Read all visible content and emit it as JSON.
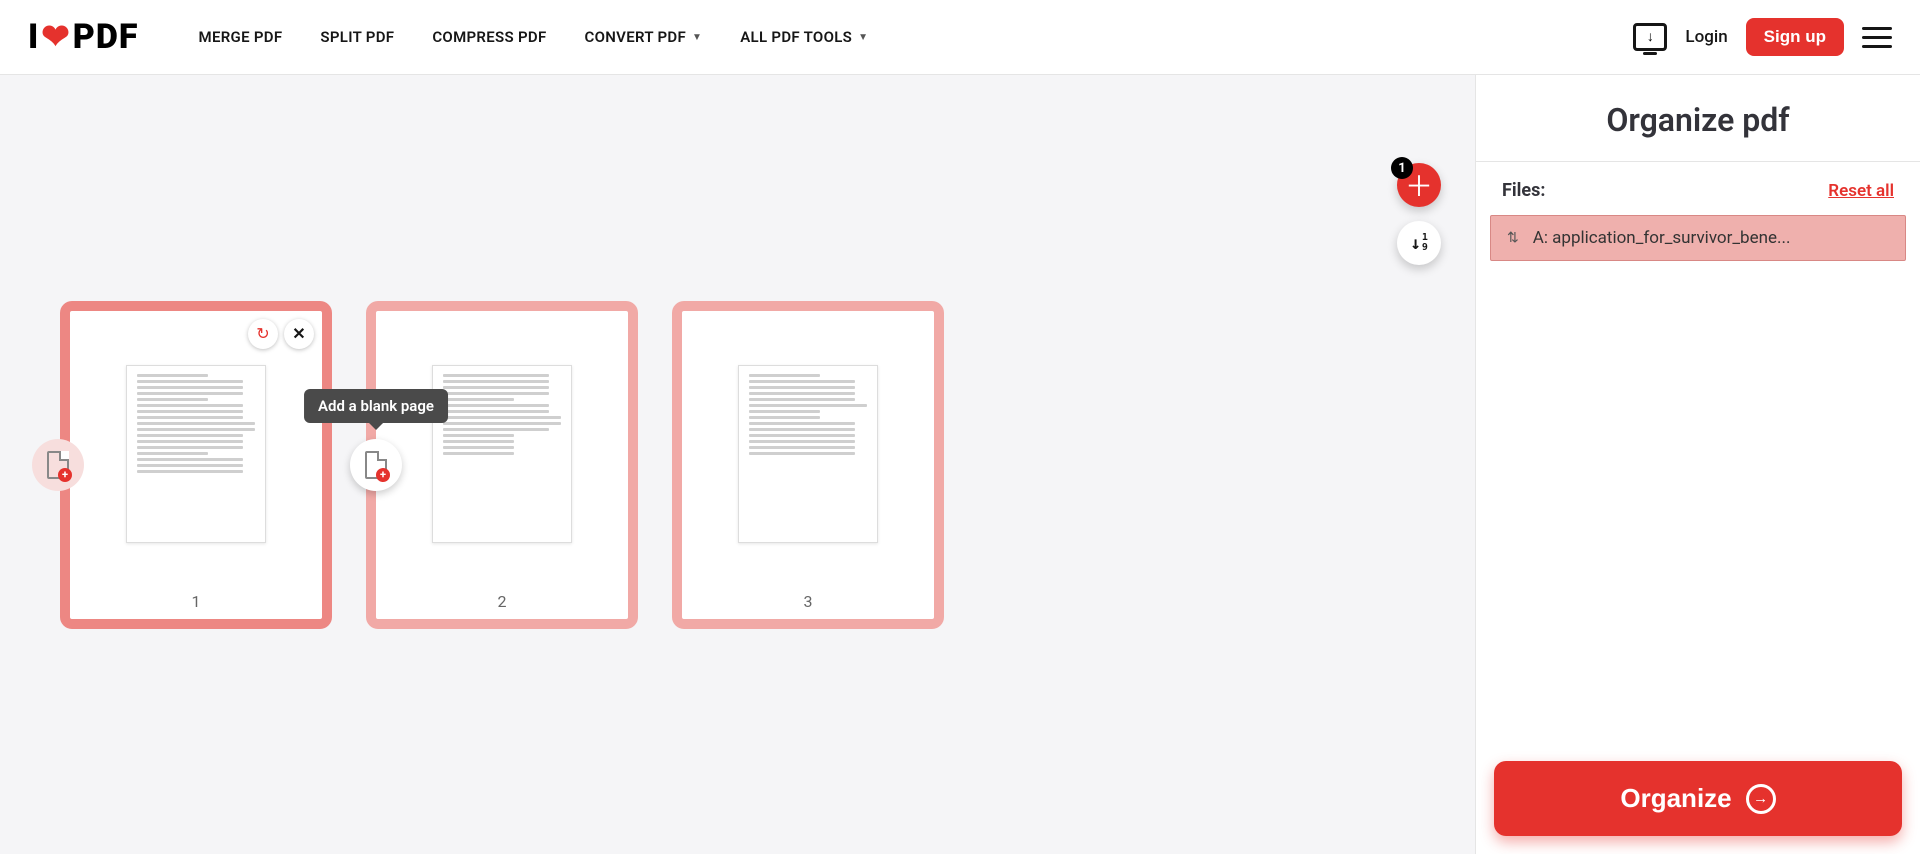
{
  "header": {
    "logo_pre": "I",
    "logo_post": "PDF",
    "nav": {
      "merge": "MERGE PDF",
      "split": "SPLIT PDF",
      "compress": "COMPRESS PDF",
      "convert": "CONVERT PDF",
      "all": "ALL PDF TOOLS"
    },
    "login": "Login",
    "signup": "Sign up"
  },
  "canvas": {
    "add_badge": "1",
    "tooltip": "Add a blank page",
    "pages": [
      {
        "num": "1"
      },
      {
        "num": "2"
      },
      {
        "num": "3"
      }
    ]
  },
  "sidebar": {
    "title": "Organize pdf",
    "files_label": "Files:",
    "reset": "Reset all",
    "file_name": "A: application_for_survivor_bene...",
    "organize": "Organize"
  }
}
